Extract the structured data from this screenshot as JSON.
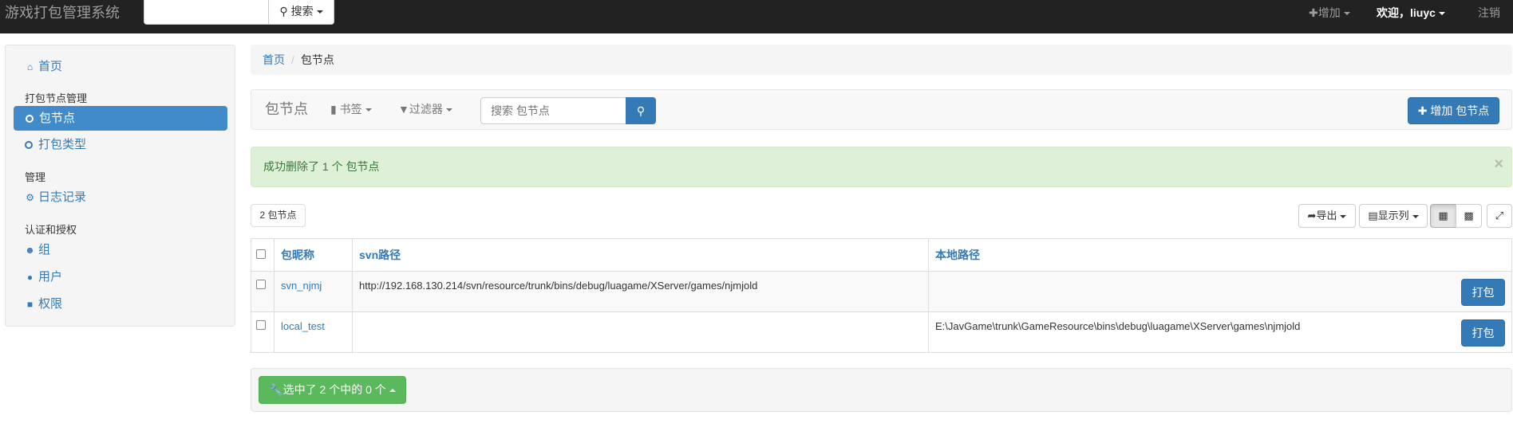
{
  "navbar": {
    "brand": "游戏打包管理系统",
    "search_label": "搜索",
    "add_label": "增加",
    "welcome_label": "欢迎，liuyc",
    "logout_label": "注销"
  },
  "sidebar": {
    "home": "首页",
    "section_package": "打包节点管理",
    "items_package": [
      {
        "label": "包节点"
      },
      {
        "label": "打包类型"
      }
    ],
    "section_admin": "管理",
    "log": "日志记录",
    "section_auth": "认证和授权",
    "group": "组",
    "user": "用户",
    "permission": "权限"
  },
  "breadcrumb": {
    "home": "首页",
    "separator": "/",
    "current": "包节点"
  },
  "toolbar": {
    "title": "包节点",
    "bookmark": "书签",
    "filter": "过滤器",
    "search_placeholder": "搜索 包节点",
    "add_button": "增加 包节点"
  },
  "alert": {
    "message": "成功删除了 1 个 包节点",
    "close": "×"
  },
  "result": {
    "count": "2 包节点",
    "export": "导出",
    "columns": "显示列"
  },
  "table": {
    "headers": [
      "包昵称",
      "svn路径",
      "本地路径"
    ],
    "rows": [
      {
        "name": "svn_njmj",
        "svn": "http://192.168.130.214/svn/resource/trunk/bins/debug/luagame/XServer/games/njmjold",
        "local": "",
        "action": "打包"
      },
      {
        "name": "local_test",
        "svn": "",
        "local": "E:\\JavGame\\trunk\\GameResource\\bins\\debug\\luagame\\XServer\\games\\njmjold",
        "action": "打包"
      }
    ]
  },
  "footer": {
    "selection": "选中了 2 个中的 0 个"
  },
  "colors": {
    "primary": "#337ab7",
    "navbar": "#222222",
    "success": "#5cb85c",
    "alert_bg": "#dff0d8",
    "alert_text": "#3c763d"
  }
}
